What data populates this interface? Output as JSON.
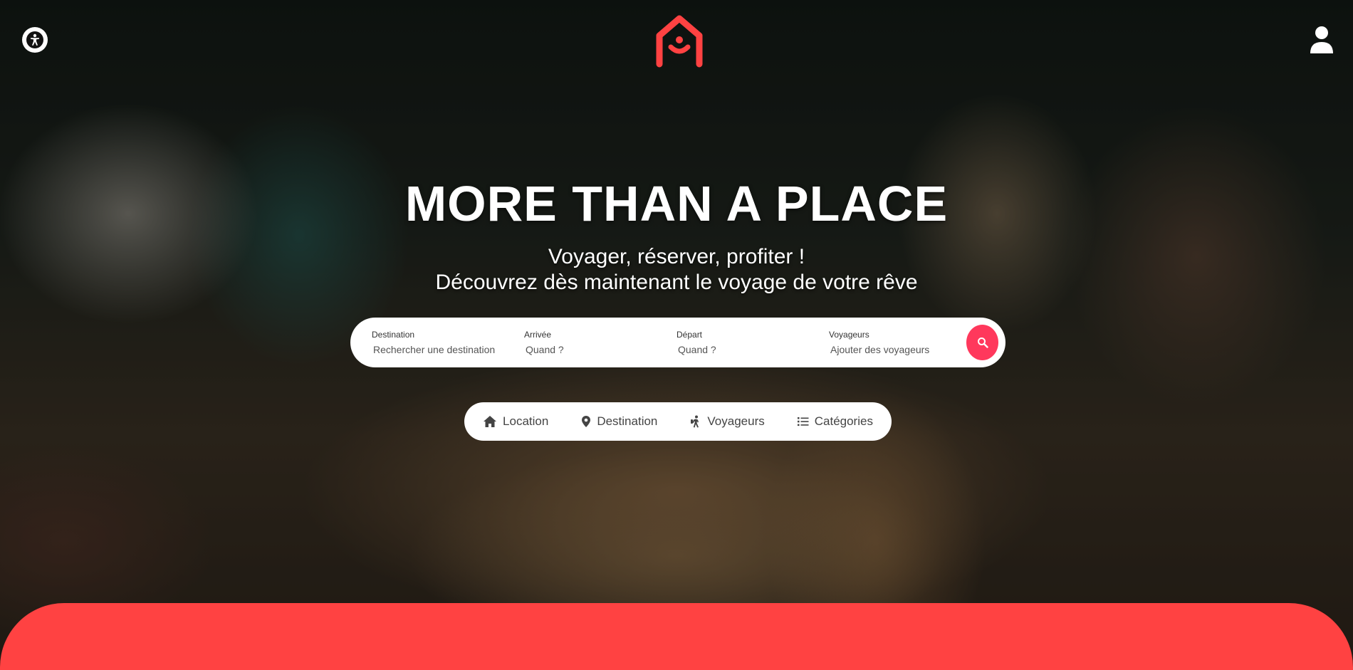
{
  "hero": {
    "headline": "MORE THAN A PLACE",
    "tagline_line1": "Voyager, réserver, profiter !",
    "tagline_line2": "Découvrez dès maintenant le voyage de votre rêve"
  },
  "header": {
    "accessibility_icon": "accessibility-icon",
    "logo_icon": "house-smile-logo-icon",
    "user_icon": "user-icon"
  },
  "search": {
    "fields": [
      {
        "label": "Destination",
        "placeholder": "Rechercher une destination"
      },
      {
        "label": "Arrivée",
        "placeholder": "Quand ?"
      },
      {
        "label": "Départ",
        "placeholder": "Quand ?"
      },
      {
        "label": "Voyageurs",
        "placeholder": "Ajouter des voyageurs"
      }
    ],
    "button_icon": "search-icon"
  },
  "quick_nav": {
    "items": [
      {
        "label": "Location",
        "icon": "home-icon"
      },
      {
        "label": "Destination",
        "icon": "map-pin-icon"
      },
      {
        "label": "Voyageurs",
        "icon": "hiker-icon"
      },
      {
        "label": "Catégories",
        "icon": "list-icon"
      }
    ]
  },
  "colors": {
    "brand": "#ff4242",
    "search_button": "#ff385c",
    "white": "#ffffff"
  }
}
